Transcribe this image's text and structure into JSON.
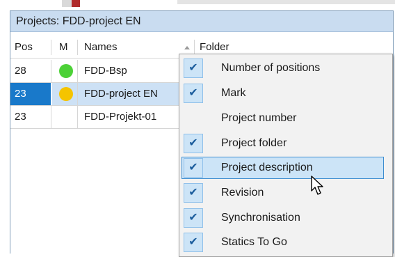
{
  "panel": {
    "title": "Projects: FDD-project EN"
  },
  "columns": [
    {
      "label": "Pos"
    },
    {
      "label": "M"
    },
    {
      "label": "Names"
    },
    {
      "label": "Folder"
    }
  ],
  "rows": [
    {
      "pos": "28",
      "mark_color": "#4cd137",
      "name": "FDD-Bsp",
      "selected": false
    },
    {
      "pos": "23",
      "mark_color": "#f5c400",
      "name": "FDD-project EN",
      "selected": true
    },
    {
      "pos": "23",
      "mark_color": "",
      "name": "FDD-Projekt-01",
      "selected": false
    }
  ],
  "context_menu": {
    "items": [
      {
        "label": "Number of positions",
        "checked": true
      },
      {
        "label": "Mark",
        "checked": true
      },
      {
        "label": "Project number",
        "checked": false
      },
      {
        "label": "Project folder",
        "checked": true
      },
      {
        "label": "Project description",
        "checked": true,
        "hovered": true
      },
      {
        "label": "Revision",
        "checked": true
      },
      {
        "label": "Synchronisation",
        "checked": true
      },
      {
        "label": "Statics To Go",
        "checked": true
      }
    ]
  },
  "colors": {
    "title_bar": "#c9dcf0",
    "selected_pos": "#1979ca",
    "selected_row": "#cde1f5",
    "check_bg": "#cce4f7"
  }
}
